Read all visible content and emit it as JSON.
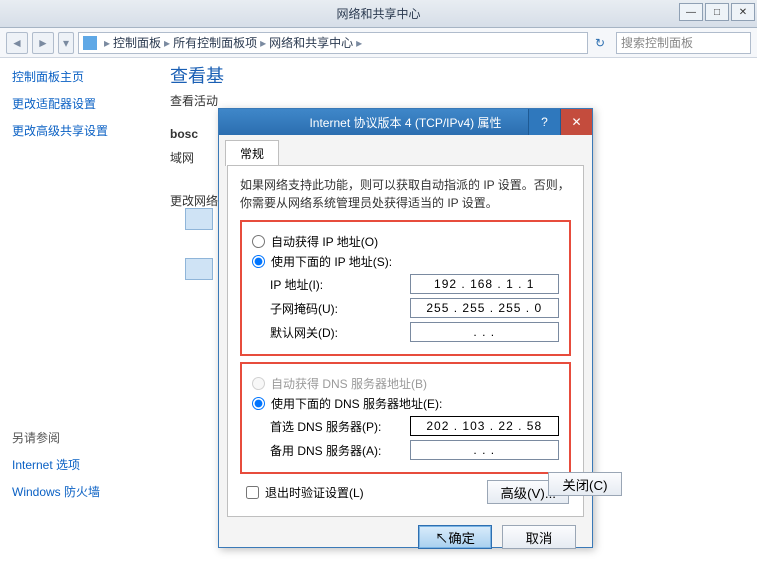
{
  "parentWindow": {
    "title": "网络和共享中心"
  },
  "breadcrumb": {
    "seg1": "控制面板",
    "seg2": "所有控制面板项",
    "seg3": "网络和共享中心"
  },
  "search": {
    "placeholder": "搜索控制面板"
  },
  "sidebar": {
    "home": "控制面板主页",
    "adapter": "更改适配器设置",
    "advshare": "更改高级共享设置",
    "seeAlsoHeader": "另请参阅",
    "inetOpts": "Internet 选项",
    "firewall": "Windows 防火墙"
  },
  "background": {
    "heading": "查看基",
    "activeLabel": "查看活动",
    "boscLabel": "bosc",
    "domainLabel": "域网",
    "changeNetLabel": "更改网络"
  },
  "dialog": {
    "title": "Internet 协议版本 4 (TCP/IPv4) 属性",
    "tabGeneral": "常规",
    "desc": "如果网络支持此功能，则可以获取自动指派的 IP 设置。否则，你需要从网络系统管理员处获得适当的 IP 设置。",
    "radioAutoIP": "自动获得 IP 地址(O)",
    "radioManualIP": "使用下面的 IP 地址(S):",
    "ipLabel": "IP 地址(I):",
    "ipValue": "192 . 168 .   1  .   1",
    "maskLabel": "子网掩码(U):",
    "maskValue": "255 . 255 . 255 .   0",
    "gwLabel": "默认网关(D):",
    "gwValue": ".        .        .",
    "radioAutoDNS": "自动获得 DNS 服务器地址(B)",
    "radioManualDNS": "使用下面的 DNS 服务器地址(E):",
    "dns1Label": "首选 DNS 服务器(P):",
    "dns1Value": "202 . 103 .  22 .  58",
    "dns2Label": "备用 DNS 服务器(A):",
    "dns2Value": ".        .        .",
    "validateOnExit": "退出时验证设置(L)",
    "advanced": "高级(V)...",
    "ok": "确定",
    "cancel": "取消"
  },
  "behind": {
    "close": "关闭(C)"
  }
}
